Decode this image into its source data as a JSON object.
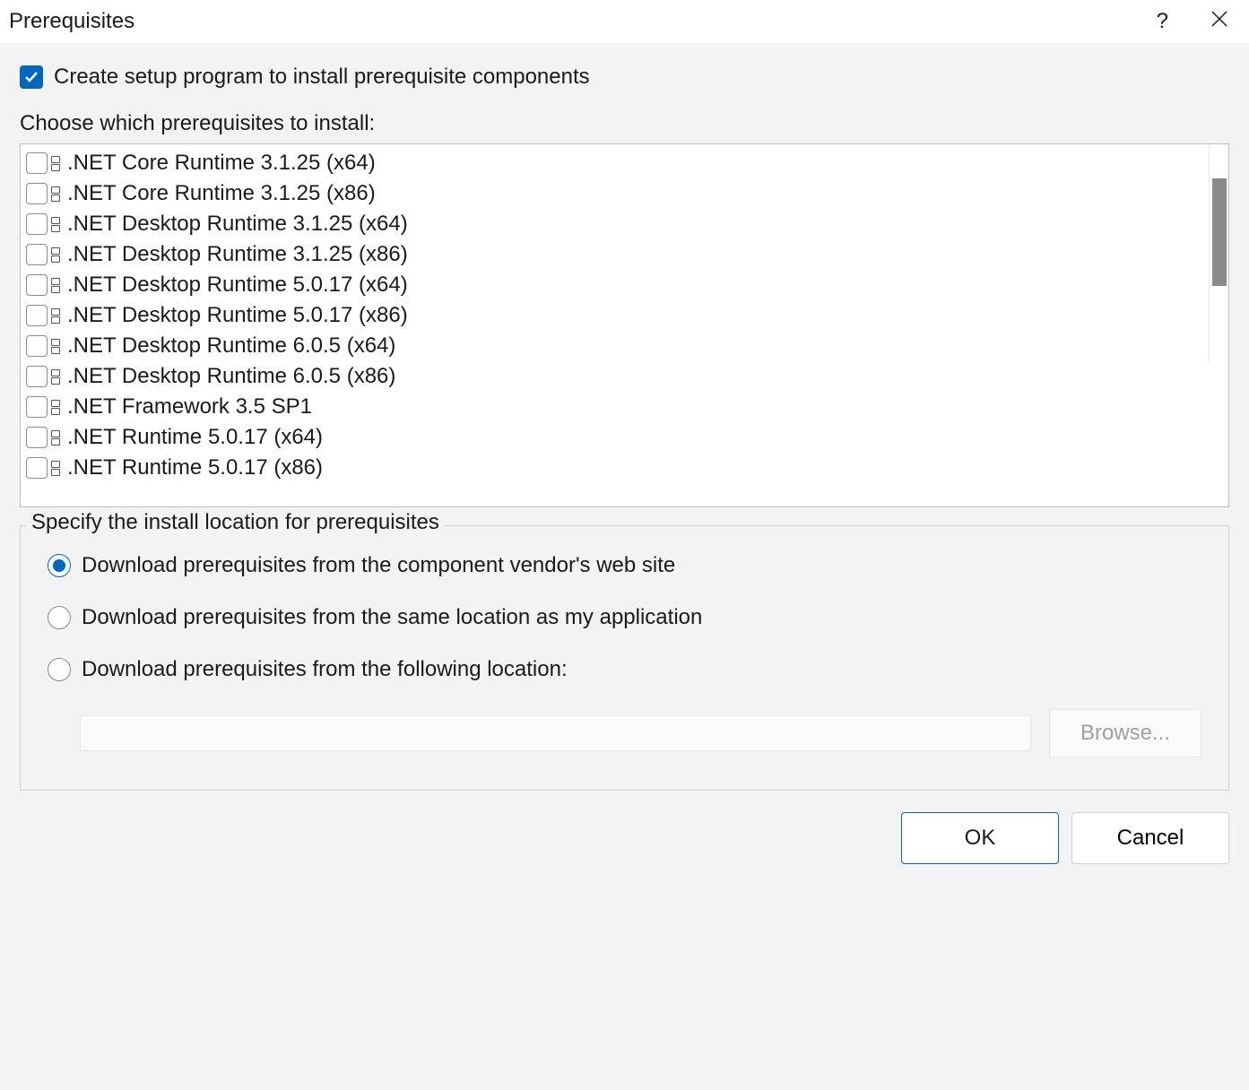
{
  "titlebar": {
    "title": "Prerequisites"
  },
  "create_setup": {
    "label": "Create setup program to install prerequisite components",
    "checked": true
  },
  "choose_label": "Choose which prerequisites to install:",
  "prerequisites": [
    {
      "label": ".NET Core Runtime 3.1.25 (x64)",
      "checked": false
    },
    {
      "label": ".NET Core Runtime 3.1.25 (x86)",
      "checked": false
    },
    {
      "label": ".NET Desktop Runtime 3.1.25 (x64)",
      "checked": false
    },
    {
      "label": ".NET Desktop Runtime 3.1.25 (x86)",
      "checked": false
    },
    {
      "label": ".NET Desktop Runtime 5.0.17 (x64)",
      "checked": false
    },
    {
      "label": ".NET Desktop Runtime 5.0.17 (x86)",
      "checked": false
    },
    {
      "label": ".NET Desktop Runtime 6.0.5 (x64)",
      "checked": false
    },
    {
      "label": ".NET Desktop Runtime 6.0.5 (x86)",
      "checked": false
    },
    {
      "label": ".NET Framework 3.5 SP1",
      "checked": false
    },
    {
      "label": ".NET Runtime 5.0.17 (x64)",
      "checked": false
    },
    {
      "label": ".NET Runtime 5.0.17 (x86)",
      "checked": false
    }
  ],
  "location": {
    "legend": "Specify the install location for prerequisites",
    "options": [
      {
        "label": "Download prerequisites from the component vendor's web site",
        "selected": true
      },
      {
        "label": "Download prerequisites from the same location as my application",
        "selected": false
      },
      {
        "label": "Download prerequisites from the following location:",
        "selected": false
      }
    ],
    "path": "",
    "browse_label": "Browse..."
  },
  "buttons": {
    "ok": "OK",
    "cancel": "Cancel"
  }
}
